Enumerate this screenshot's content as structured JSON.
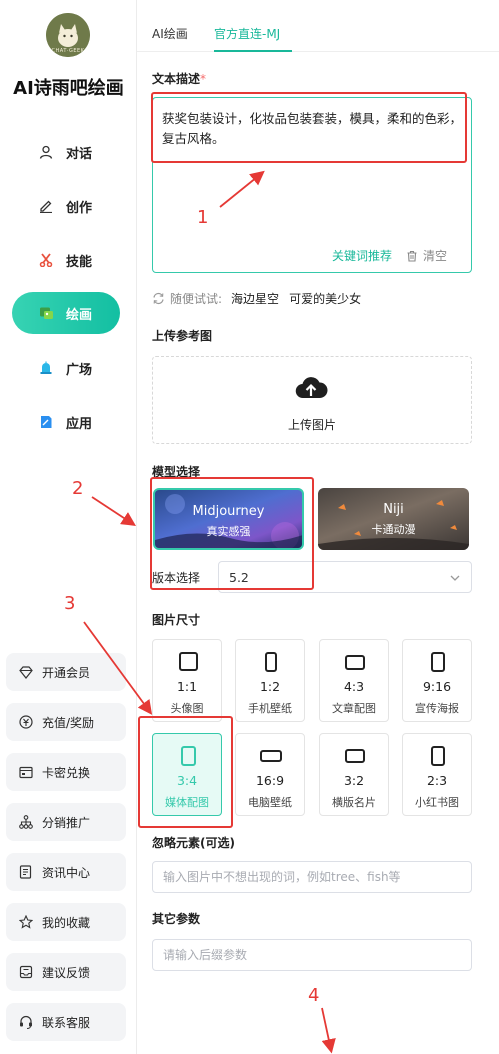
{
  "app": {
    "logo_text": "CHAT·GEEK",
    "title": "AI诗雨吧绘画"
  },
  "nav": [
    {
      "label": "对话",
      "icon": "user-icon"
    },
    {
      "label": "创作",
      "icon": "pencil-icon"
    },
    {
      "label": "技能",
      "icon": "scissors-icon"
    },
    {
      "label": "绘画",
      "icon": "image-icon",
      "active": true
    },
    {
      "label": "广场",
      "icon": "lamp-icon"
    },
    {
      "label": "应用",
      "icon": "app-icon"
    }
  ],
  "tools": [
    {
      "label": "开通会员",
      "icon": "diamond-icon"
    },
    {
      "label": "充值/奖励",
      "icon": "coin-icon"
    },
    {
      "label": "卡密兑换",
      "icon": "card-icon"
    },
    {
      "label": "分销推广",
      "icon": "network-icon"
    },
    {
      "label": "资讯中心",
      "icon": "document-icon"
    },
    {
      "label": "我的收藏",
      "icon": "star-icon"
    },
    {
      "label": "建议反馈",
      "icon": "inbox-icon"
    },
    {
      "label": "联系客服",
      "icon": "headset-icon"
    }
  ],
  "tabs": [
    {
      "label": "AI绘画",
      "active": false
    },
    {
      "label": "官方直连-MJ",
      "active": true
    }
  ],
  "prompt": {
    "label": "文本描述",
    "required_mark": "*",
    "value": "获奖包装设计，化妆品包装套装，模具，柔和的色彩，复古风格。",
    "keyword_button": "关键词推荐",
    "clear_button": "清空"
  },
  "random": {
    "label": "随便试试:",
    "samples": [
      "海边星空",
      "可爱的美少女"
    ]
  },
  "upload": {
    "title": "上传参考图",
    "button_label": "上传图片"
  },
  "model": {
    "title": "模型选择",
    "options": [
      {
        "name": "Midjourney",
        "subtitle": "真实感强",
        "selected": true
      },
      {
        "name": "Niji",
        "subtitle": "卡通动漫",
        "selected": false
      }
    ],
    "version_label": "版本选择",
    "version_value": "5.2"
  },
  "size": {
    "title": "图片尺寸",
    "options": [
      {
        "ratio": "1:1",
        "desc": "头像图"
      },
      {
        "ratio": "1:2",
        "desc": "手机壁纸"
      },
      {
        "ratio": "4:3",
        "desc": "文章配图"
      },
      {
        "ratio": "9:16",
        "desc": "宣传海报"
      },
      {
        "ratio": "3:4",
        "desc": "媒体配图",
        "selected": true
      },
      {
        "ratio": "16:9",
        "desc": "电脑壁纸"
      },
      {
        "ratio": "3:2",
        "desc": "横版名片"
      },
      {
        "ratio": "2:3",
        "desc": "小红书图"
      }
    ]
  },
  "ignore": {
    "title": "忽略元素(可选)",
    "placeholder": "输入图片中不想出现的词，例如tree、fish等"
  },
  "other": {
    "title": "其它参数",
    "placeholder": "请输入后缀参数"
  },
  "annotations": [
    "1",
    "2",
    "3",
    "4"
  ],
  "colors": {
    "accent": "#19b89a",
    "annotation_red": "#e53935"
  }
}
